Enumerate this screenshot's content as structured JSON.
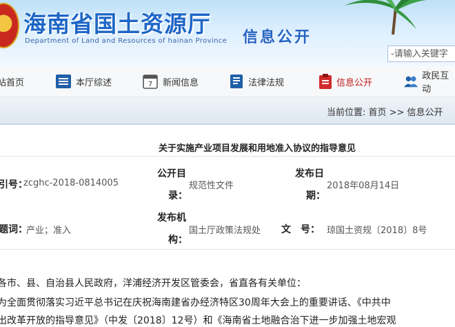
{
  "header": {
    "site_title": "海南省国土资源厅",
    "site_subtitle": "Department of Land and Resources of hainan Province",
    "section_name": "信息公开",
    "search_placeholder": "-请输入关键字"
  },
  "nav": {
    "items": [
      {
        "label": "站首页",
        "icon": "home-icon"
      },
      {
        "label": "本厅综述",
        "icon": "list-icon"
      },
      {
        "label": "新闻信息",
        "icon": "calendar-icon"
      },
      {
        "label": "法律法规",
        "icon": "book-icon"
      },
      {
        "label": "信息公开",
        "icon": "clipboard-icon",
        "active": true
      },
      {
        "label": "政民互动",
        "icon": "people-icon"
      }
    ]
  },
  "breadcrumb": {
    "text": "当前位置: 首页 >> 信息公开"
  },
  "article": {
    "title": "关于实施产业项目发展和用地准入协议的指导意见",
    "meta": {
      "index_label": "引号：",
      "index_value": "zcghc-2018-0814005",
      "catalog_label_1": "公开目",
      "catalog_label_2": "录：",
      "catalog_value": "规范性文件",
      "date_label_1": "发布日",
      "date_label_2": "期：",
      "date_value": "2018年08月14日",
      "keywords_label": "题词：",
      "keywords_value": "产业；准入",
      "publisher_label_1": "发布机",
      "publisher_label_2": "构：",
      "publisher_value": "国土厅政策法规处",
      "docno_label": "文　号：",
      "docno_value": "琼国土资规〔2018〕8号 "
    },
    "paragraphs": [
      "各市、县、自治县人民政府，洋浦经济开发区管委会，省直各有关单位：",
      "为全面贯彻落实习近平总书记在庆祝海南建省办经济特区30周年大会上的重要讲话、《中共中",
      "出改革开放的指导意见》（中发〔2018〕12号）和《海南省土地融合治下进一步加强土地宏观"
    ]
  },
  "colors": {
    "title_blue": "#1e66c6",
    "active_red": "#c21a1a"
  }
}
